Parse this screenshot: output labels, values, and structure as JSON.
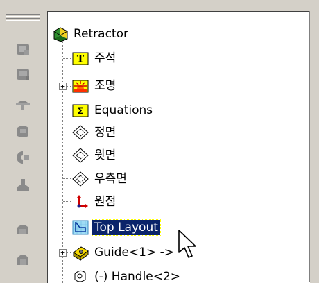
{
  "tree": {
    "root": {
      "label": "Retractor",
      "icon": "assembly-icon"
    },
    "items": [
      {
        "label": "주석",
        "icon": "annotations-icon",
        "expandable": false
      },
      {
        "label": "조명",
        "icon": "lights-icon",
        "expandable": true
      },
      {
        "label": "Equations",
        "icon": "equations-icon",
        "expandable": false
      },
      {
        "label": "정면",
        "icon": "plane-icon",
        "expandable": false
      },
      {
        "label": "윗면",
        "icon": "plane-icon",
        "expandable": false
      },
      {
        "label": "우측면",
        "icon": "plane-icon",
        "expandable": false
      },
      {
        "label": "원점",
        "icon": "origin-icon",
        "expandable": false
      },
      {
        "label": "Top Layout",
        "icon": "sketch-icon",
        "expandable": false,
        "selected": true
      },
      {
        "label": "Guide<1> ->",
        "icon": "part-icon",
        "expandable": true
      },
      {
        "label": "(-) Handle<2>",
        "icon": "part-icon",
        "expandable": true
      }
    ]
  },
  "toolbar": {
    "buttons": [
      "toolbar-button-1",
      "toolbar-button-2",
      "toolbar-button-3",
      "toolbar-button-4",
      "toolbar-button-5",
      "toolbar-button-6",
      "toolbar-button-7",
      "toolbar-button-8"
    ]
  },
  "colors": {
    "selection": "#0a246a",
    "toolbar_icon": "#8a8a8a"
  }
}
